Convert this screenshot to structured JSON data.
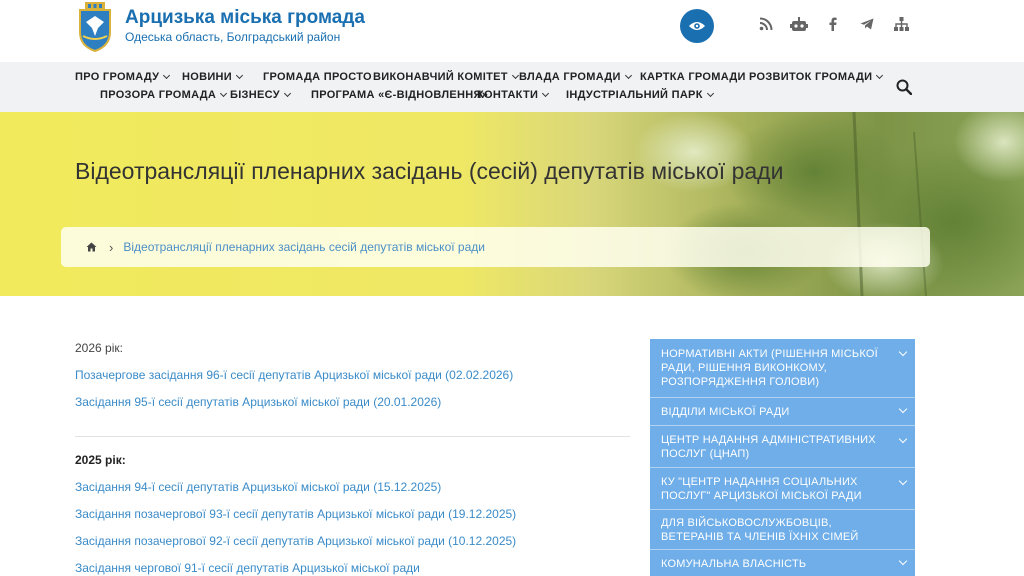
{
  "header": {
    "title": "Арцизька міська громада",
    "subtitle": "Одеська область, Болградський район",
    "icons": [
      "eye-icon",
      "rss-icon",
      "robot-icon",
      "facebook-icon",
      "telegram-icon",
      "sitemap-icon"
    ]
  },
  "nav": {
    "row1": [
      {
        "label": "ПРО ГРОМАДУ",
        "dropdown": true
      },
      {
        "label": "НОВИНИ",
        "dropdown": true
      },
      {
        "label": "ГРОМАДА ПРОСТО",
        "dropdown": false
      },
      {
        "label": "ВИКОНАВЧИЙ КОМІТЕТ",
        "dropdown": true
      },
      {
        "label": "ВЛАДА ГРОМАДИ",
        "dropdown": true
      },
      {
        "label": "КАРТКА ГРОМАДИ",
        "dropdown": false
      },
      {
        "label": "РОЗВИТОК ГРОМАДИ",
        "dropdown": true
      }
    ],
    "row2": [
      {
        "label": "ПРОЗОРА ГРОМАДА",
        "dropdown": true
      },
      {
        "label": "БІЗНЕСУ",
        "dropdown": true
      },
      {
        "label": "ПРОГРАМА «Є-ВІДНОВЛЕННЯ»",
        "dropdown": false
      },
      {
        "label": "КОНТАКТИ",
        "dropdown": true
      },
      {
        "label": "ІНДУСТРІАЛЬНИЙ ПАРК",
        "dropdown": true
      }
    ]
  },
  "banner": {
    "heading": "Відеотрансляції пленарних засідань (сесій) депутатів міської ради",
    "breadcrumb": "Відеотрансляції пленарних засідань сесій депутатів міської ради"
  },
  "content": {
    "year2026": "2026 рік:",
    "links2026": [
      "Позачергове засідання 96-ї сесії депутатів Арцизької міської ради (02.02.2026)",
      "Засідання 95-ї сесії депутатів Арцизької міської ради (20.01.2026)"
    ],
    "year2025": "2025 рік:",
    "links2025": [
      "Засідання 94-ї сесії депутатів Арцизької міської ради (15.12.2025)",
      "Засідання позачергової 93-ї сесії депутатів Арцизької міської ради (19.12.2025)",
      "Засідання позачергової 92-ї сесії депутатів Арцизької міської ради (10.12.2025)",
      "Засідання чергової 91-ї сесії депутатів Арцизької міської ради"
    ]
  },
  "sidebar": {
    "items": [
      "НОРМАТИВНІ АКТИ (РІШЕННЯ МІСЬКОЇ РАДИ, РІШЕННЯ ВИКОНКОМУ, РОЗПОРЯДЖЕННЯ ГОЛОВИ)",
      "ВІДДІЛИ МІСЬКОЇ РАДИ",
      "ЦЕНТР НАДАННЯ АДМІНІСТРАТИВНИХ ПОСЛУГ (ЦНАП)",
      "КУ \"ЦЕНТР НАДАННЯ СОЦІАЛЬНИХ ПОСЛУГ\" АРЦИЗЬКОЇ МІСЬКОЇ РАДИ",
      "ДЛЯ ВІЙСЬКОВОСЛУЖБОВЦІВ, ВЕТЕРАНІВ ТА ЧЛЕНІВ ЇХНІХ СІМЕЙ",
      "КОМУНАЛЬНА ВЛАСНІСТЬ"
    ],
    "expandable": [
      true,
      true,
      true,
      true,
      false,
      true
    ]
  },
  "colors": {
    "brand": "#1a6fb0",
    "link": "#3a8bc8",
    "sidebar": "#6faee8",
    "banner": "#f1ea5c"
  }
}
